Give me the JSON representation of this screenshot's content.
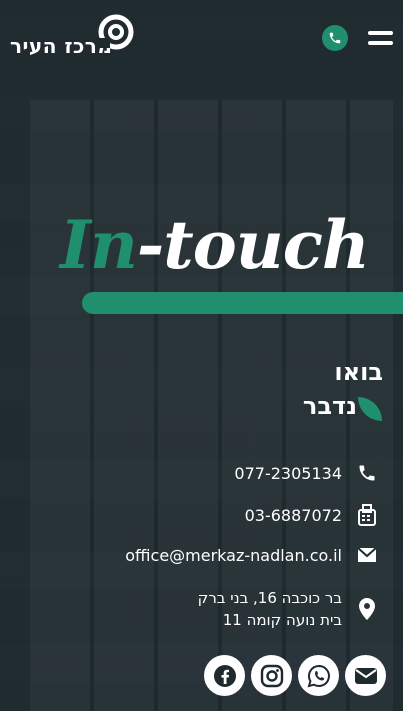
{
  "brand": {
    "logo_text": "מרכז העיר",
    "accent_color": "#1f8f6e"
  },
  "header": {
    "menu_icon": "hamburger-icon",
    "phone_icon": "phone-icon"
  },
  "hero": {
    "title_accent": "In",
    "title_rest": "-touch"
  },
  "section": {
    "heading_line1": "בואו",
    "heading_line2": "נדבר"
  },
  "contact": {
    "phone": "077-2305134",
    "fax": "03-6887072",
    "email": "office@merkaz-nadlan.co.il",
    "address_line1": "בר כוכבה 16, בני ברק",
    "address_line2": "בית נועה קומה 11"
  },
  "socials": [
    {
      "name": "email",
      "icon": "envelope-icon"
    },
    {
      "name": "whatsapp",
      "icon": "whatsapp-icon"
    },
    {
      "name": "instagram",
      "icon": "instagram-icon"
    },
    {
      "name": "facebook",
      "icon": "facebook-icon"
    }
  ]
}
